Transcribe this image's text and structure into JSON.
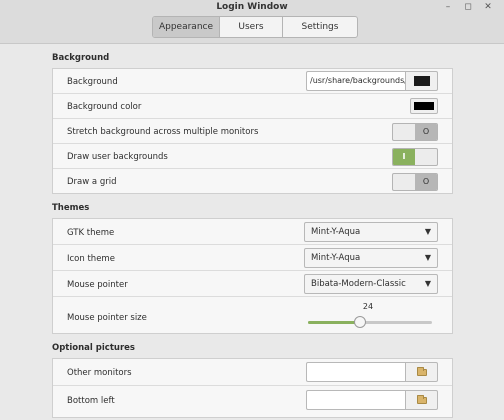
{
  "window": {
    "title": "Login Window",
    "minimize_glyph": "–",
    "maximize_glyph": "◻",
    "close_glyph": "✕"
  },
  "tabs": [
    {
      "label": "Appearance",
      "active": true
    },
    {
      "label": "Users",
      "active": false
    },
    {
      "label": "Settings",
      "active": false
    }
  ],
  "background_section": {
    "title": "Background",
    "rows": {
      "background": {
        "label": "Background",
        "value": "/usr/share/backgrounds/"
      },
      "background_color": {
        "label": "Background color",
        "color": "#000000"
      },
      "stretch": {
        "label": "Stretch background across multiple monitors",
        "state": "off",
        "glyph": "O"
      },
      "draw_user_backgrounds": {
        "label": "Draw user backgrounds",
        "state": "on",
        "glyph": "I"
      },
      "draw_grid": {
        "label": "Draw a grid",
        "state": "off",
        "glyph": "O"
      }
    }
  },
  "themes_section": {
    "title": "Themes",
    "rows": {
      "gtk_theme": {
        "label": "GTK theme",
        "value": "Mint-Y-Aqua"
      },
      "icon_theme": {
        "label": "Icon theme",
        "value": "Mint-Y-Aqua"
      },
      "mouse_pointer": {
        "label": "Mouse pointer",
        "value": "Bibata-Modern-Classic"
      },
      "mouse_pointer_size": {
        "label": "Mouse pointer size",
        "value": "24",
        "fraction": 0.42
      }
    }
  },
  "optional_pictures_section": {
    "title": "Optional pictures",
    "rows": {
      "other_monitors": {
        "label": "Other monitors",
        "value": ""
      },
      "bottom_left": {
        "label": "Bottom left",
        "value": ""
      }
    }
  },
  "colors": {
    "accent": "#8ab15e"
  },
  "icons": {
    "dropdown": "chevron-down-icon",
    "folder": "folder-icon"
  }
}
